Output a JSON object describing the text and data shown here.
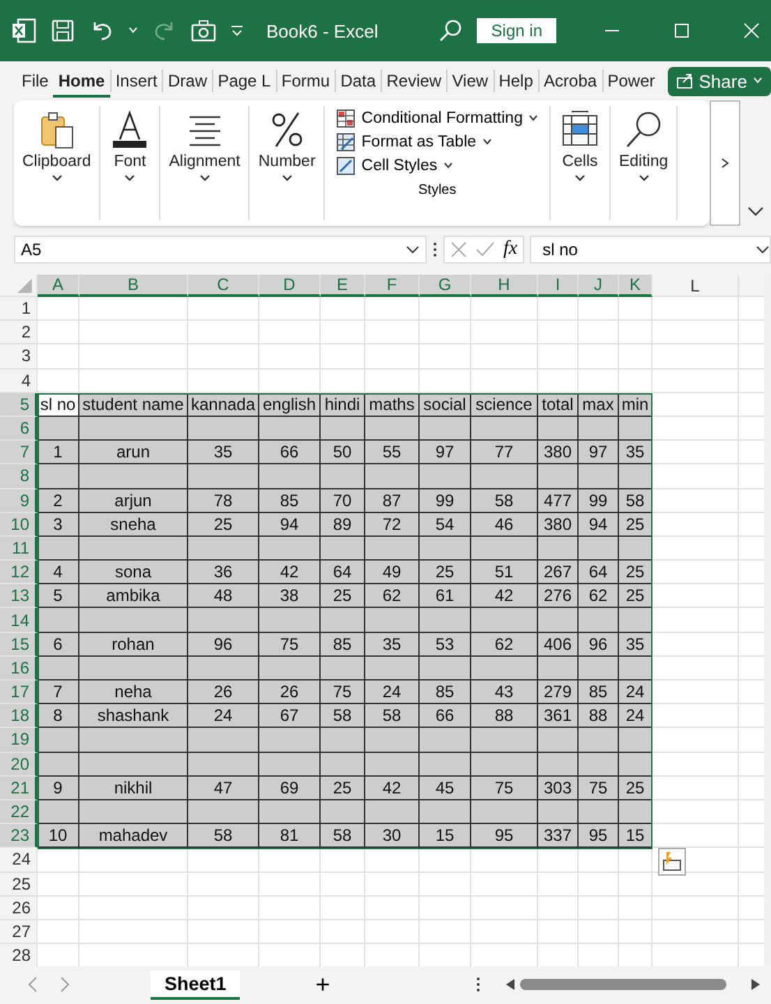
{
  "title_bar": {
    "title": "Book6  -  Excel",
    "sign_in": "Sign in"
  },
  "tabs": [
    {
      "label": "File",
      "selected": false
    },
    {
      "label": "Home",
      "selected": true
    },
    {
      "label": "Insert",
      "selected": false
    },
    {
      "label": "Draw",
      "selected": false
    },
    {
      "label": "Page L",
      "selected": false
    },
    {
      "label": "Formu",
      "selected": false
    },
    {
      "label": "Data",
      "selected": false
    },
    {
      "label": "Review",
      "selected": false
    },
    {
      "label": "View",
      "selected": false
    },
    {
      "label": "Help",
      "selected": false
    },
    {
      "label": "Acroba",
      "selected": false
    },
    {
      "label": "Power",
      "selected": false
    }
  ],
  "share": "Share",
  "ribbon": {
    "groups": [
      {
        "kind": "clipboard",
        "label": "Clipboard"
      },
      {
        "kind": "font",
        "label": "Font"
      },
      {
        "kind": "alignment",
        "label": "Alignment"
      },
      {
        "kind": "number",
        "label": "Number"
      }
    ],
    "styles": {
      "items": [
        {
          "kind": "conditional",
          "label": "Conditional Formatting"
        },
        {
          "kind": "table",
          "label": "Format as Table"
        },
        {
          "kind": "cellstyles",
          "label": "Cell Styles"
        }
      ],
      "label": "Styles"
    },
    "groups_right": [
      {
        "kind": "cells",
        "label": "Cells"
      },
      {
        "kind": "editing",
        "label": "Editing"
      }
    ]
  },
  "formula_bar": {
    "name_box": "A5",
    "fx": "fx",
    "value": "sl no"
  },
  "columns": [
    {
      "label": "A",
      "selected": true
    },
    {
      "label": "B",
      "selected": true
    },
    {
      "label": "C",
      "selected": true
    },
    {
      "label": "D",
      "selected": true
    },
    {
      "label": "E",
      "selected": true
    },
    {
      "label": "F",
      "selected": true
    },
    {
      "label": "G",
      "selected": true
    },
    {
      "label": "H",
      "selected": true
    },
    {
      "label": "I",
      "selected": true
    },
    {
      "label": "J",
      "selected": true
    },
    {
      "label": "K",
      "selected": true
    },
    {
      "label": "L",
      "selected": false
    }
  ],
  "rows": [
    {
      "number": "1",
      "selected": false
    },
    {
      "number": "2",
      "selected": false
    },
    {
      "number": "3",
      "selected": false
    },
    {
      "number": "4",
      "selected": false
    },
    {
      "number": "5",
      "selected": true,
      "active": true,
      "cells": [
        "sl no",
        "student name",
        "kannada",
        "english",
        "hindi",
        "maths",
        "social",
        "science",
        "total",
        "max",
        "min"
      ]
    },
    {
      "number": "6",
      "selected": true,
      "active": false
    },
    {
      "number": "7",
      "selected": true,
      "active": false,
      "cells": [
        "1",
        "arun",
        "35",
        "66",
        "50",
        "55",
        "97",
        "77",
        "380",
        "97",
        "35"
      ]
    },
    {
      "number": "8",
      "selected": true,
      "active": false
    },
    {
      "number": "9",
      "selected": true,
      "active": false,
      "cells": [
        "2",
        "arjun",
        "78",
        "85",
        "70",
        "87",
        "99",
        "58",
        "477",
        "99",
        "58"
      ]
    },
    {
      "number": "10",
      "selected": true,
      "active": false,
      "cells": [
        "3",
        "sneha",
        "25",
        "94",
        "89",
        "72",
        "54",
        "46",
        "380",
        "94",
        "25"
      ]
    },
    {
      "number": "11",
      "selected": true,
      "active": false
    },
    {
      "number": "12",
      "selected": true,
      "active": false,
      "cells": [
        "4",
        "sona",
        "36",
        "42",
        "64",
        "49",
        "25",
        "51",
        "267",
        "64",
        "25"
      ]
    },
    {
      "number": "13",
      "selected": true,
      "active": false,
      "cells": [
        "5",
        "ambika",
        "48",
        "38",
        "25",
        "62",
        "61",
        "42",
        "276",
        "62",
        "25"
      ]
    },
    {
      "number": "14",
      "selected": true,
      "active": false
    },
    {
      "number": "15",
      "selected": true,
      "active": false,
      "cells": [
        "6",
        "rohan",
        "96",
        "75",
        "85",
        "35",
        "53",
        "62",
        "406",
        "96",
        "35"
      ]
    },
    {
      "number": "16",
      "selected": true,
      "active": false
    },
    {
      "number": "17",
      "selected": true,
      "active": false,
      "cells": [
        "7",
        "neha",
        "26",
        "26",
        "75",
        "24",
        "85",
        "43",
        "279",
        "85",
        "24"
      ]
    },
    {
      "number": "18",
      "selected": true,
      "active": false,
      "cells": [
        "8",
        "shashank",
        "24",
        "67",
        "58",
        "58",
        "66",
        "88",
        "361",
        "88",
        "24"
      ]
    },
    {
      "number": "19",
      "selected": true,
      "active": false
    },
    {
      "number": "20",
      "selected": true,
      "active": false
    },
    {
      "number": "21",
      "selected": true,
      "active": false,
      "cells": [
        "9",
        "nikhil",
        "47",
        "69",
        "25",
        "42",
        "45",
        "75",
        "303",
        "75",
        "25"
      ]
    },
    {
      "number": "22",
      "selected": true,
      "active": false
    },
    {
      "number": "23",
      "selected": true,
      "active": false,
      "cells": [
        "10",
        "mahadev",
        "58",
        "81",
        "58",
        "30",
        "15",
        "95",
        "337",
        "95",
        "15"
      ]
    },
    {
      "number": "24",
      "selected": false
    },
    {
      "number": "25",
      "selected": false
    },
    {
      "number": "26",
      "selected": false
    },
    {
      "number": "27",
      "selected": false
    },
    {
      "number": "28",
      "selected": false
    }
  ],
  "sheets": [
    {
      "label": "Sheet1",
      "selected": true
    }
  ],
  "add_sheet": "+"
}
